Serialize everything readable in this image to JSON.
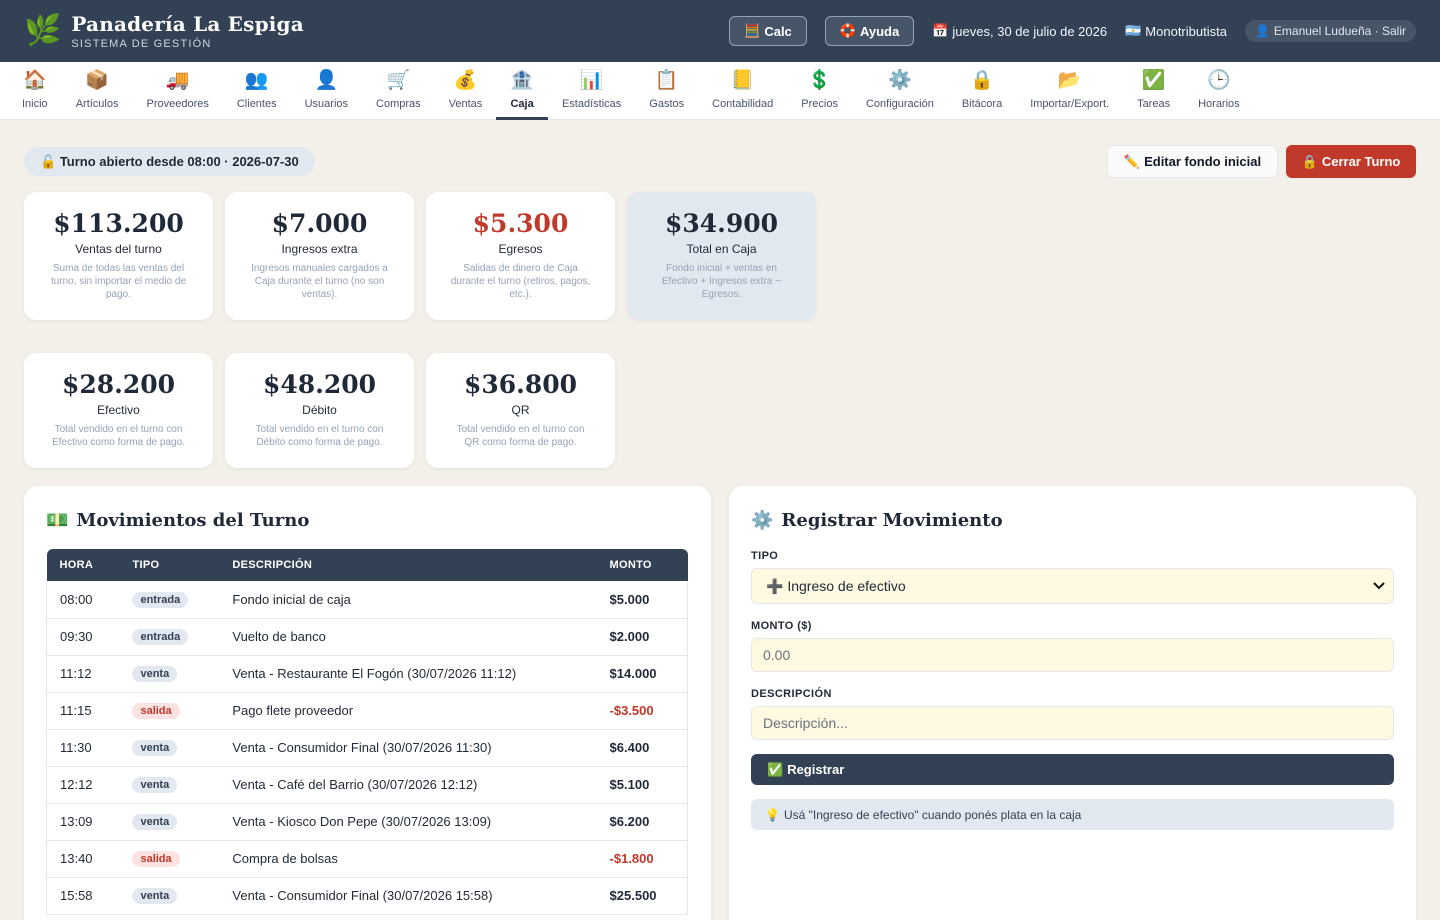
{
  "header": {
    "title": "Panadería La Espiga",
    "subtitle": "SISTEMA DE GESTIÓN",
    "logo_icon": "🌿",
    "calc_icon": "🧮",
    "calc_label": "Calc",
    "help_icon": "🛟",
    "help_label": "Ayuda",
    "date_icon": "📅",
    "date": "jueves, 30 de julio de 2026",
    "flag_icon": "🇦🇷",
    "tax_regime": "Monotributista",
    "user_icon": "👤",
    "user": "Emanuel Ludueña · Salir"
  },
  "nav": [
    {
      "icon": "🏠",
      "label": "Inicio"
    },
    {
      "icon": "📦",
      "label": "Artículos"
    },
    {
      "icon": "🚚",
      "label": "Proveedores"
    },
    {
      "icon": "👥",
      "label": "Clientes"
    },
    {
      "icon": "👤",
      "label": "Usuarios"
    },
    {
      "icon": "🛒",
      "label": "Compras"
    },
    {
      "icon": "💰",
      "label": "Ventas"
    },
    {
      "icon": "🏦",
      "label": "Caja"
    },
    {
      "icon": "📊",
      "label": "Estadísticas"
    },
    {
      "icon": "📋",
      "label": "Gastos"
    },
    {
      "icon": "📒",
      "label": "Contabilidad"
    },
    {
      "icon": "💲",
      "label": "Precios"
    },
    {
      "icon": "⚙️",
      "label": "Configuración"
    },
    {
      "icon": "🔒",
      "label": "Bitácora"
    },
    {
      "icon": "📂",
      "label": "Importar/Export."
    },
    {
      "icon": "✅",
      "label": "Tareas"
    },
    {
      "icon": "🕒",
      "label": "Horarios"
    }
  ],
  "shift": {
    "icon": "🔓",
    "status": "Turno abierto desde 08:00 · 2026-07-30",
    "edit_icon": "✏️",
    "edit_label": "Editar fondo inicial",
    "close_icon": "🔒",
    "close_label": "Cerrar Turno"
  },
  "summary": [
    {
      "value": "$113.200",
      "label": "Ventas del turno",
      "desc": "Suma de todas las ventas del turno, sin importar el medio de pago."
    },
    {
      "value": "$7.000",
      "label": "Ingresos extra",
      "desc": "Ingresos manuales cargados a Caja durante el turno (no son ventas)."
    },
    {
      "value": "$5.300",
      "label": "Egresos",
      "desc": "Salidas de dinero de Caja durante el turno (retiros, pagos, etc.)."
    },
    {
      "value": "$34.900",
      "label": "Total en Caja",
      "desc": "Fondo inicial + ventas en Efectivo + Ingresos extra − Egresos."
    }
  ],
  "payment_methods": [
    {
      "value": "$28.200",
      "label": "Efectivo",
      "desc": "Total vendido en el turno con Efectivo como forma de pago."
    },
    {
      "value": "$48.200",
      "label": "Débito",
      "desc": "Total vendido en el turno con Débito como forma de pago."
    },
    {
      "value": "$36.800",
      "label": "QR",
      "desc": "Total vendido en el turno con QR como forma de pago."
    }
  ],
  "movements": {
    "icon": "💵",
    "title": "Movimientos del Turno",
    "columns": [
      "HORA",
      "TIPO",
      "DESCRIPCIÓN",
      "MONTO"
    ],
    "rows": [
      {
        "time": "08:00",
        "type": "entrada",
        "desc": "Fondo inicial de caja",
        "amount": "$5.000"
      },
      {
        "time": "09:30",
        "type": "entrada",
        "desc": "Vuelto de banco",
        "amount": "$2.000"
      },
      {
        "time": "11:12",
        "type": "venta",
        "desc": "Venta - Restaurante El Fogón (30/07/2026 11:12)",
        "amount": "$14.000"
      },
      {
        "time": "11:15",
        "type": "salida",
        "desc": "Pago flete proveedor",
        "amount": "-$3.500"
      },
      {
        "time": "11:30",
        "type": "venta",
        "desc": "Venta - Consumidor Final (30/07/2026 11:30)",
        "amount": "$6.400"
      },
      {
        "time": "12:12",
        "type": "venta",
        "desc": "Venta - Café del Barrio (30/07/2026 12:12)",
        "amount": "$5.100"
      },
      {
        "time": "13:09",
        "type": "venta",
        "desc": "Venta - Kiosco Don Pepe (30/07/2026 13:09)",
        "amount": "$6.200"
      },
      {
        "time": "13:40",
        "type": "salida",
        "desc": "Compra de bolsas",
        "amount": "-$1.800"
      },
      {
        "time": "15:58",
        "type": "venta",
        "desc": "Venta - Consumidor Final (30/07/2026 15:58)",
        "amount": "$25.500"
      }
    ]
  },
  "register": {
    "icon": "⚙️",
    "title": "Registrar Movimiento",
    "type_label": "TIPO",
    "type_value": "➕ Ingreso de efectivo",
    "amount_label": "MONTO ($)",
    "amount_placeholder": "0.00",
    "desc_label": "DESCRIPCIÓN",
    "desc_placeholder": "Descripción...",
    "submit_icon": "✅",
    "submit_label": "Registrar",
    "tip_icon": "💡",
    "tip": "Usá \"Ingreso de efectivo\" cuando ponés plata en la caja"
  }
}
